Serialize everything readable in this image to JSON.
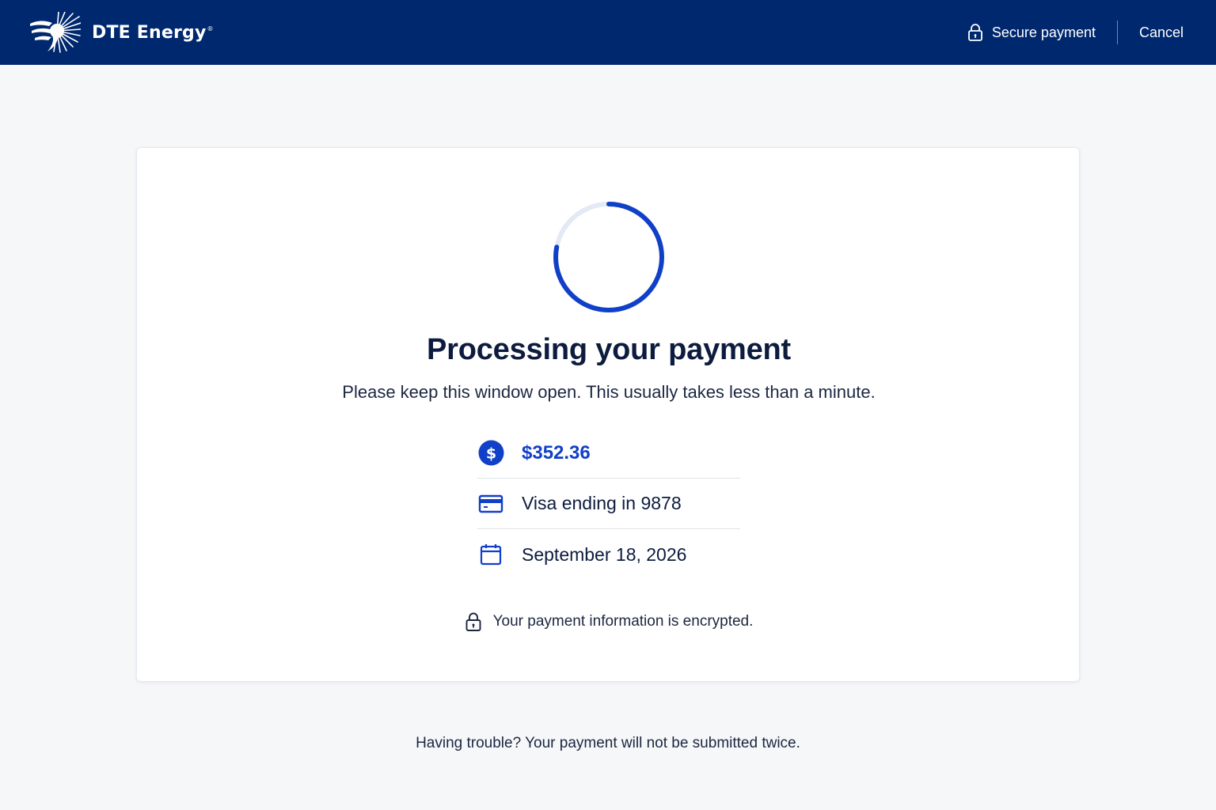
{
  "header": {
    "brand_name": "DTE Energy",
    "brand_mark": "®",
    "secure_label": "Secure payment",
    "cancel_label": "Cancel"
  },
  "processing": {
    "title": "Processing your payment",
    "subtitle": "Please keep this window open. This usually takes less than a minute.",
    "progress_fraction": 0.78
  },
  "details": {
    "amount": "$352.36",
    "payment_method": "Visa ending in 9878",
    "date": "September 18, 2026"
  },
  "security_note": "Your payment information is encrypted.",
  "help_text": "Having trouble? Your payment will not be submitted twice.",
  "icons": {
    "logo": "sunburst-logo-icon",
    "secure": "lock-icon",
    "amount": "dollar-icon",
    "card": "credit-card-icon",
    "date": "calendar-icon",
    "encrypt": "lock-icon"
  },
  "colors": {
    "header_bg": "#00286e",
    "accent": "#1140c8",
    "spinner_track": "#e3e9f5",
    "text": "#0d1b3e",
    "page_bg": "#f6f7f9"
  }
}
